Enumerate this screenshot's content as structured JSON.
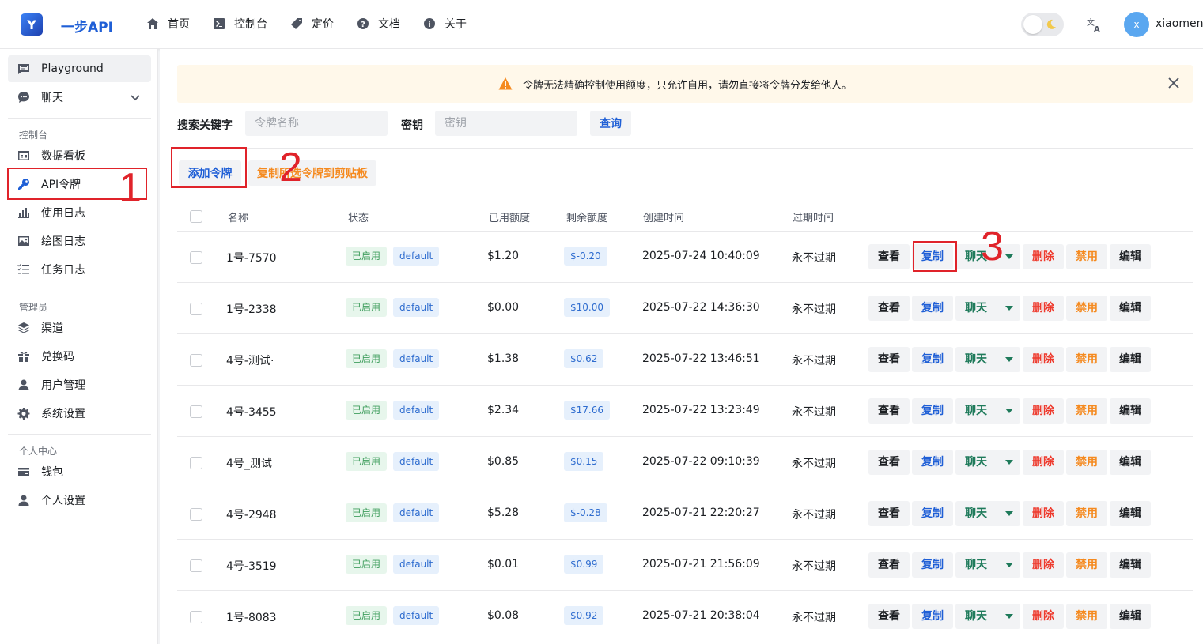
{
  "header": {
    "logo_text": "Y",
    "brand": "一步API",
    "nav": [
      {
        "label": "首页",
        "icon": "home-icon"
      },
      {
        "label": "控制台",
        "icon": "terminal-icon"
      },
      {
        "label": "定价",
        "icon": "tag-icon"
      },
      {
        "label": "文档",
        "icon": "help-icon"
      },
      {
        "label": "关于",
        "icon": "info-icon"
      }
    ],
    "avatar_letter": "x",
    "username": "xiaomeng"
  },
  "sidebar": {
    "playground": "Playground",
    "chat": "聊天",
    "section_console": "控制台",
    "console_items": [
      "数据看板",
      "API令牌",
      "使用日志",
      "绘图日志",
      "任务日志"
    ],
    "section_admin": "管理员",
    "admin_items": [
      "渠道",
      "兑换码",
      "用户管理",
      "系统设置"
    ],
    "section_personal": "个人中心",
    "personal_items": [
      "钱包",
      "个人设置"
    ]
  },
  "alert": {
    "text": "令牌无法精确控制使用额度，只允许自用，请勿直接将令牌分发给他人。"
  },
  "search": {
    "keyword_label": "搜索关键字",
    "name_placeholder": "令牌名称",
    "key_label": "密钥",
    "key_placeholder": "密钥",
    "query_button": "查询"
  },
  "toolbar": {
    "add_button": "添加令牌",
    "copy_all_button": "复制所选令牌到剪贴板"
  },
  "table": {
    "headers": [
      "名称",
      "状态",
      "已用额度",
      "剩余额度",
      "创建时间",
      "过期时间"
    ],
    "actions": {
      "view": "查看",
      "copy": "复制",
      "chat": "聊天",
      "delete": "删除",
      "disable": "禁用",
      "edit": "编辑"
    },
    "rows": [
      {
        "name": "1号-7570",
        "status": "已启用",
        "group": "default",
        "used": "$1.20",
        "remaining": "$-0.20",
        "created": "2025-07-24 10:40:09",
        "expires": "永不过期"
      },
      {
        "name": "1号-2338",
        "status": "已启用",
        "group": "default",
        "used": "$0.00",
        "remaining": "$10.00",
        "created": "2025-07-22 14:36:30",
        "expires": "永不过期"
      },
      {
        "name": "4号-测试·",
        "status": "已启用",
        "group": "default",
        "used": "$1.38",
        "remaining": "$0.62",
        "created": "2025-07-22 13:46:51",
        "expires": "永不过期"
      },
      {
        "name": "4号-3455",
        "status": "已启用",
        "group": "default",
        "used": "$2.34",
        "remaining": "$17.66",
        "created": "2025-07-22 13:23:49",
        "expires": "永不过期"
      },
      {
        "name": "4号_测试",
        "status": "已启用",
        "group": "default",
        "used": "$0.85",
        "remaining": "$0.15",
        "created": "2025-07-22 09:10:39",
        "expires": "永不过期"
      },
      {
        "name": "4号-2948",
        "status": "已启用",
        "group": "default",
        "used": "$5.28",
        "remaining": "$-0.28",
        "created": "2025-07-21 22:20:27",
        "expires": "永不过期"
      },
      {
        "name": "4号-3519",
        "status": "已启用",
        "group": "default",
        "used": "$0.01",
        "remaining": "$0.99",
        "created": "2025-07-21 21:56:09",
        "expires": "永不过期"
      },
      {
        "name": "1号-8083",
        "status": "已启用",
        "group": "default",
        "used": "$0.08",
        "remaining": "$0.92",
        "created": "2025-07-21 20:38:04",
        "expires": "永不过期"
      }
    ]
  },
  "annotations": [
    "1",
    "2",
    "3"
  ],
  "colors": {
    "primary": "#1f5fd6",
    "annotation": "#e0232a",
    "warning": "#f58a1f",
    "danger": "#ee3a2d"
  }
}
